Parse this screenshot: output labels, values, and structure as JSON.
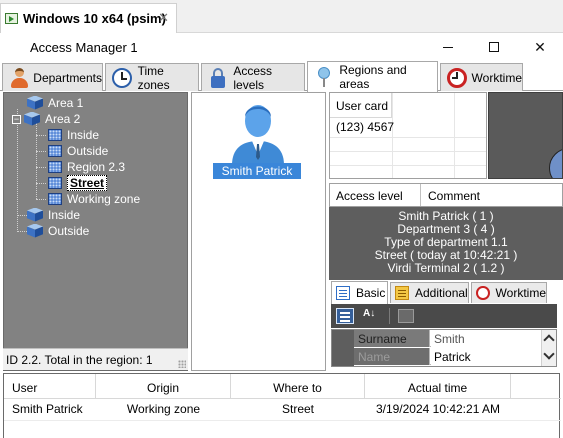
{
  "vm_tab": {
    "title": "Windows 10 x64 (psim)",
    "close_glyph": "✕"
  },
  "app": {
    "title": "Access Manager 1"
  },
  "window_controls": {
    "close_glyph": "✕"
  },
  "tabs": [
    {
      "label": "Departments",
      "icon": "person-icon"
    },
    {
      "label": "Time zones",
      "icon": "clock-icon"
    },
    {
      "label": "Access levels",
      "icon": "lock-icon"
    },
    {
      "label": "Regions and areas",
      "icon": "pin-icon",
      "active": true
    },
    {
      "label": "Worktime",
      "icon": "alarm-clock-icon"
    }
  ],
  "tree": {
    "items": [
      {
        "label": "Area 1"
      },
      {
        "label": "Area 2",
        "expander": "−"
      },
      {
        "label": "Inside"
      },
      {
        "label": "Outside"
      },
      {
        "label": "Region 2.3"
      },
      {
        "label": "Street",
        "selected": true
      },
      {
        "label": "Working zone"
      },
      {
        "label": "Inside"
      },
      {
        "label": "Outside"
      }
    ],
    "status": "ID 2.2. Total in the region: 1"
  },
  "person": {
    "name": "Smith Patrick"
  },
  "card": {
    "header": "User card",
    "value": "(123) 4567"
  },
  "info": {
    "col_access_level": "Access level",
    "col_comment": "Comment",
    "lines": [
      "Smith Patrick ( 1 )",
      "Department 3 ( 4 )",
      "Type of department 1.1",
      "Street ( today at 10:42:21 )",
      "Virdi Terminal 2 ( 1.2 )"
    ]
  },
  "subtabs": [
    {
      "label": "Basic",
      "active": true
    },
    {
      "label": "Additional"
    },
    {
      "label": "Worktime"
    }
  ],
  "properties": [
    {
      "key": "Surname",
      "value": "Smith"
    },
    {
      "key": "Name",
      "value": "Patrick"
    }
  ],
  "events": {
    "columns": [
      "User",
      "Origin",
      "Where to",
      "Actual time"
    ],
    "rows": [
      {
        "user": "Smith Patrick",
        "origin": "Working zone",
        "where_to": "Street",
        "actual_time": "3/19/2024 10:42:21 AM"
      }
    ]
  }
}
